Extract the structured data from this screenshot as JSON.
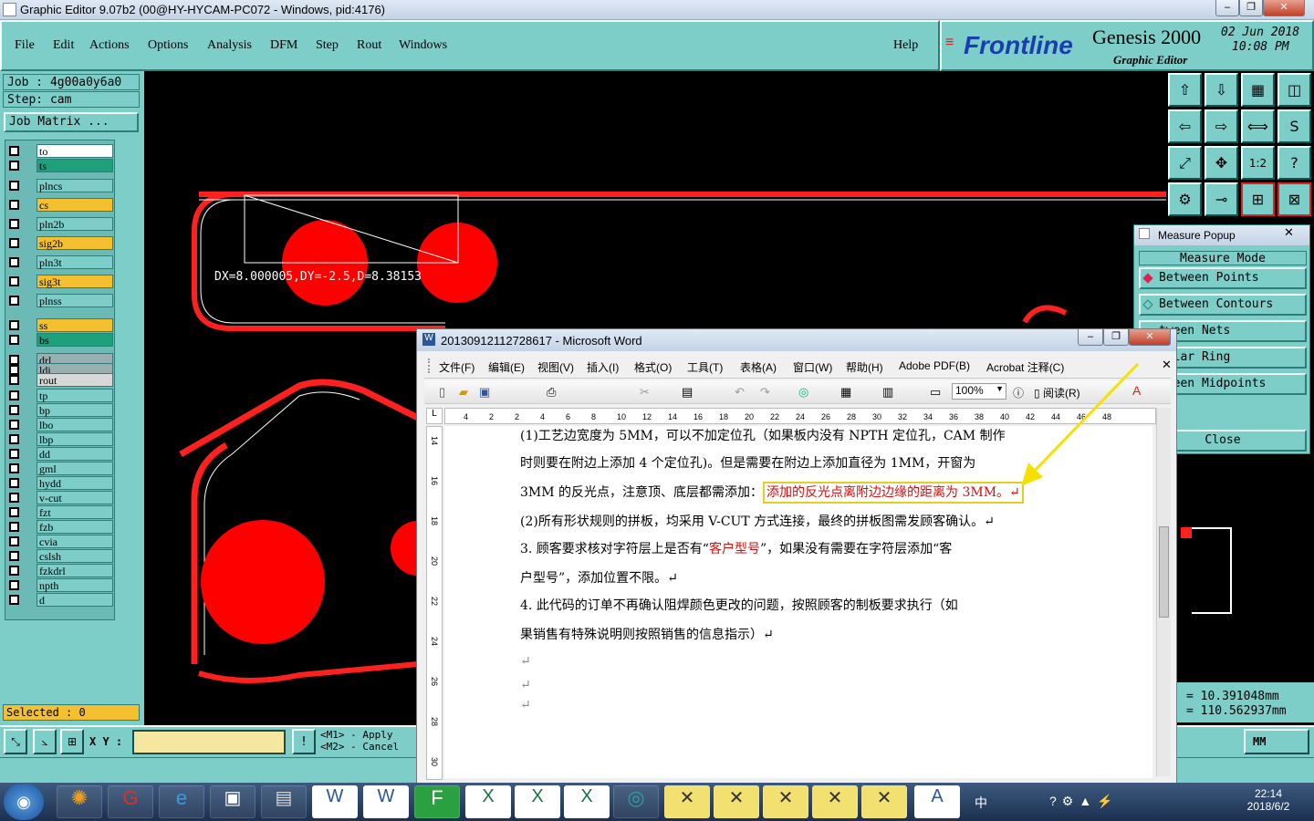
{
  "window": {
    "title": "Graphic Editor 9.07b2 (00@HY-HYCAM-PC072 - Windows, pid:4176)"
  },
  "menu": [
    "File",
    "Edit",
    "Actions",
    "Options",
    "Analysis",
    "DFM",
    "Step",
    "Rout",
    "Windows"
  ],
  "help": "Help",
  "brand": {
    "logo": "Frontline",
    "product": "Genesis 2000",
    "subtitle": "Graphic Editor",
    "date": "02 Jun 2018",
    "time": "10:08 PM"
  },
  "job": {
    "job": "Job : 4g00a0y6a0",
    "step": "Step: cam",
    "matrix": "Job Matrix ..."
  },
  "layers": [
    {
      "name": "to",
      "color": "#ffffff"
    },
    {
      "name": "ts",
      "color": "#1ea07a"
    },
    {
      "name": "plncs",
      "color": "#7dcdc8"
    },
    {
      "name": "cs",
      "color": "#f5c030"
    },
    {
      "name": "pln2b",
      "color": "#7dcdc8"
    },
    {
      "name": "sig2b",
      "color": "#f5c030"
    },
    {
      "name": "pln3t",
      "color": "#7dcdc8"
    },
    {
      "name": "sig3t",
      "color": "#f5c030"
    },
    {
      "name": "plnss",
      "color": "#7dcdc8"
    },
    {
      "name": "ss",
      "color": "#f5c030"
    },
    {
      "name": "bs",
      "color": "#1ea07a"
    },
    {
      "name": "drl",
      "color": "#9ab0b0"
    },
    {
      "name": "ldi",
      "color": "#9ab0b0"
    },
    {
      "name": "rout",
      "color": "#d8d8d8"
    },
    {
      "name": "tp",
      "color": "#7dcdc8"
    },
    {
      "name": "bp",
      "color": "#7dcdc8"
    },
    {
      "name": "lbo",
      "color": "#7dcdc8"
    },
    {
      "name": "lbp",
      "color": "#7dcdc8"
    },
    {
      "name": "dd",
      "color": "#7dcdc8"
    },
    {
      "name": "gml",
      "color": "#7dcdc8"
    },
    {
      "name": "hydd",
      "color": "#7dcdc8"
    },
    {
      "name": "v-cut",
      "color": "#7dcdc8"
    },
    {
      "name": "fzt",
      "color": "#7dcdc8"
    },
    {
      "name": "fzb",
      "color": "#7dcdc8"
    },
    {
      "name": "cvia",
      "color": "#7dcdc8"
    },
    {
      "name": "cslsh",
      "color": "#7dcdc8"
    },
    {
      "name": "fzkdrl",
      "color": "#7dcdc8"
    },
    {
      "name": "npth",
      "color": "#7dcdc8"
    },
    {
      "name": "d",
      "color": "#7dcdc8"
    }
  ],
  "selected": "Selected : 0",
  "measurement": "DX=8.000005,DY=-2.5,D=8.38153",
  "statusbar": {
    "xy_label": "X Y :",
    "m1": "<M1> - Apply",
    "m2": "<M2> - Cancel",
    "units": "MM",
    "readout_x": "= 10.391048mm",
    "readout_y": "= 110.562937mm"
  },
  "measure_popup": {
    "title": "Measure Popup",
    "mode_label": "Measure Mode",
    "items": [
      "Between Points",
      "Between Contours",
      "tween Nets",
      "nular Ring",
      "tween Midpoints"
    ],
    "close": "Close"
  },
  "word": {
    "title": "20130912112728617 - Microsoft Word",
    "menu": [
      "文件(F)",
      "编辑(E)",
      "视图(V)",
      "插入(I)",
      "格式(O)",
      "工具(T)",
      "表格(A)",
      "窗口(W)",
      "帮助(H)",
      "Adobe PDF(B)",
      "Acrobat 注释(C)"
    ],
    "zoom": "100%",
    "read": "阅读(R)",
    "ruler": [
      "4",
      "2",
      "2",
      "4",
      "6",
      "8",
      "10",
      "12",
      "14",
      "16",
      "18",
      "20",
      "22",
      "24",
      "26",
      "28",
      "30",
      "32",
      "34",
      "36",
      "38",
      "40",
      "42",
      "44",
      "46",
      "48"
    ],
    "vruler": [
      "14",
      "16",
      "18",
      "20",
      "22",
      "24",
      "26",
      "28",
      "30"
    ],
    "lines": [
      "(1)工艺边宽度为 5MM，可以不加定位孔（如果板内没有 NPTH 定位孔，CAM 制作",
      "时则要在附边上添加 4 个定位孔)。但是需要在附边上添加直径为 1MM，开窗为",
      "3MM 的反光点，注意顶、底层都需添加：",
      "(2)所有形状规则的拼板，均采用 V-CUT 方式连接，最终的拼板图需发顾客确认。↵",
      "3. 顾客要求核对字符层上是否有“",
      "户型号”，添加位置不限。↵",
      "4.  此代码的订单不再确认阻焊颜色更改的问题，按照顾客的制板要求执行（如",
      "果销售有特殊说明则按照销售的信息指示）↵"
    ],
    "highlight": "添加的反光点离附边边缘的距离为 3MM。↵",
    "red_word": "客户型号",
    "line3_tail": "”，如果没有需要在字符层添加“客",
    "para_marks": [
      "↵",
      "↵",
      "↵"
    ]
  },
  "tray": {
    "ime": "中",
    "time": "22:14",
    "date": "2018/6/2"
  }
}
